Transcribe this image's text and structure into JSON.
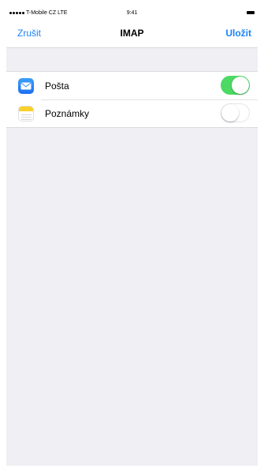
{
  "status_bar": {
    "carrier": "T-Mobile CZ",
    "network": "LTE",
    "time": "9:41"
  },
  "nav": {
    "cancel_label": "Zrušit",
    "title": "IMAP",
    "save_label": "Uložit"
  },
  "accounts": [
    {
      "label": "Pošta",
      "icon": "mail-icon",
      "enabled": true
    },
    {
      "label": "Poznámky",
      "icon": "notes-icon",
      "enabled": false
    }
  ],
  "colors": {
    "accent": "#1a82fb",
    "toggle_on": "#4cd964",
    "background": "#efeff4"
  }
}
